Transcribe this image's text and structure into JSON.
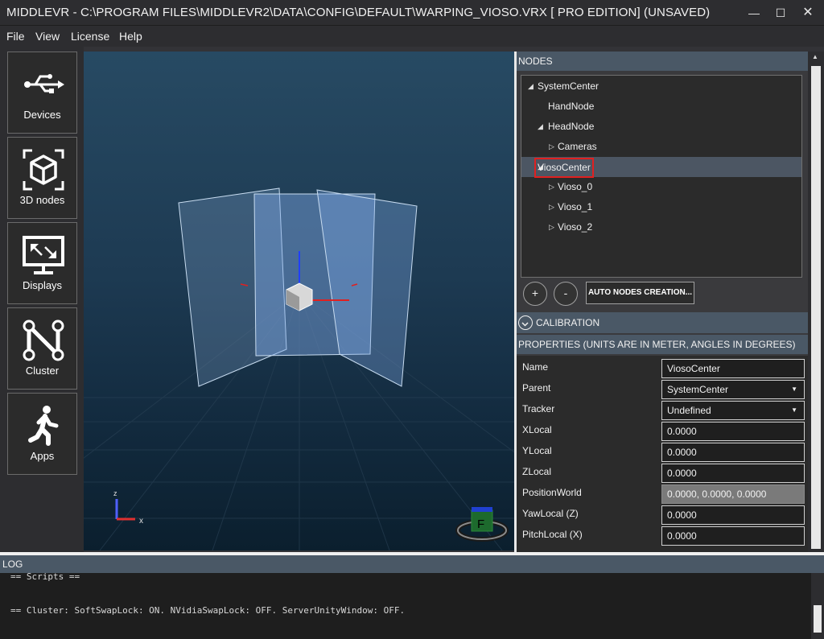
{
  "window": {
    "title": "MIDDLEVR - C:\\PROGRAM FILES\\MIDDLEVR2\\DATA\\CONFIG\\DEFAULT\\WARPING_VIOSO.VRX [ PRO EDITION] (UNSAVED)",
    "minimize": "—",
    "maximize": "☐",
    "close": "✕"
  },
  "menu": {
    "file": "File",
    "view": "View",
    "license": "License",
    "help": "Help"
  },
  "tools": {
    "devices": "Devices",
    "nodes3d": "3D nodes",
    "displays": "Displays",
    "cluster": "Cluster",
    "apps": "Apps"
  },
  "viewport": {
    "axis_z": "z",
    "axis_x": "x",
    "gizmo_label": "F"
  },
  "nodes": {
    "header": "NODES",
    "tree": [
      {
        "label": "SystemCenter",
        "expander": "◢"
      },
      {
        "label": "HandNode",
        "expander": ""
      },
      {
        "label": "HeadNode",
        "expander": "◢"
      },
      {
        "label": "Cameras",
        "expander": "▷"
      },
      {
        "label": "ViosoCenter",
        "expander": "◢"
      },
      {
        "label": "Vioso_0",
        "expander": "▷"
      },
      {
        "label": "Vioso_1",
        "expander": "▷"
      },
      {
        "label": "Vioso_2",
        "expander": "▷"
      }
    ],
    "add_button": "+",
    "remove_button": "-",
    "auto_button": "AUTO NODES CREATION..."
  },
  "calibration": {
    "header": "CALIBRATION"
  },
  "properties": {
    "header": "PROPERTIES (UNITS ARE IN METER, ANGLES IN DEGREES)",
    "rows": [
      {
        "name": "Name",
        "value": "ViosoCenter"
      },
      {
        "name": "Parent",
        "value": "SystemCenter"
      },
      {
        "name": "Tracker",
        "value": "Undefined"
      },
      {
        "name": "XLocal",
        "value": "0.0000"
      },
      {
        "name": "YLocal",
        "value": "0.0000"
      },
      {
        "name": "ZLocal",
        "value": "0.0000"
      },
      {
        "name": "PositionWorld",
        "value": "0.0000, 0.0000, 0.0000"
      },
      {
        "name": "YawLocal (Z)",
        "value": "0.0000"
      },
      {
        "name": "PitchLocal (X)",
        "value": "0.0000"
      }
    ]
  },
  "log": {
    "header": "LOG",
    "lines": [
      "== Scripts ==",
      "== Cluster: SoftSwapLock: ON. NVidiaSwapLock: OFF. ServerUnityWindow: OFF."
    ]
  }
}
